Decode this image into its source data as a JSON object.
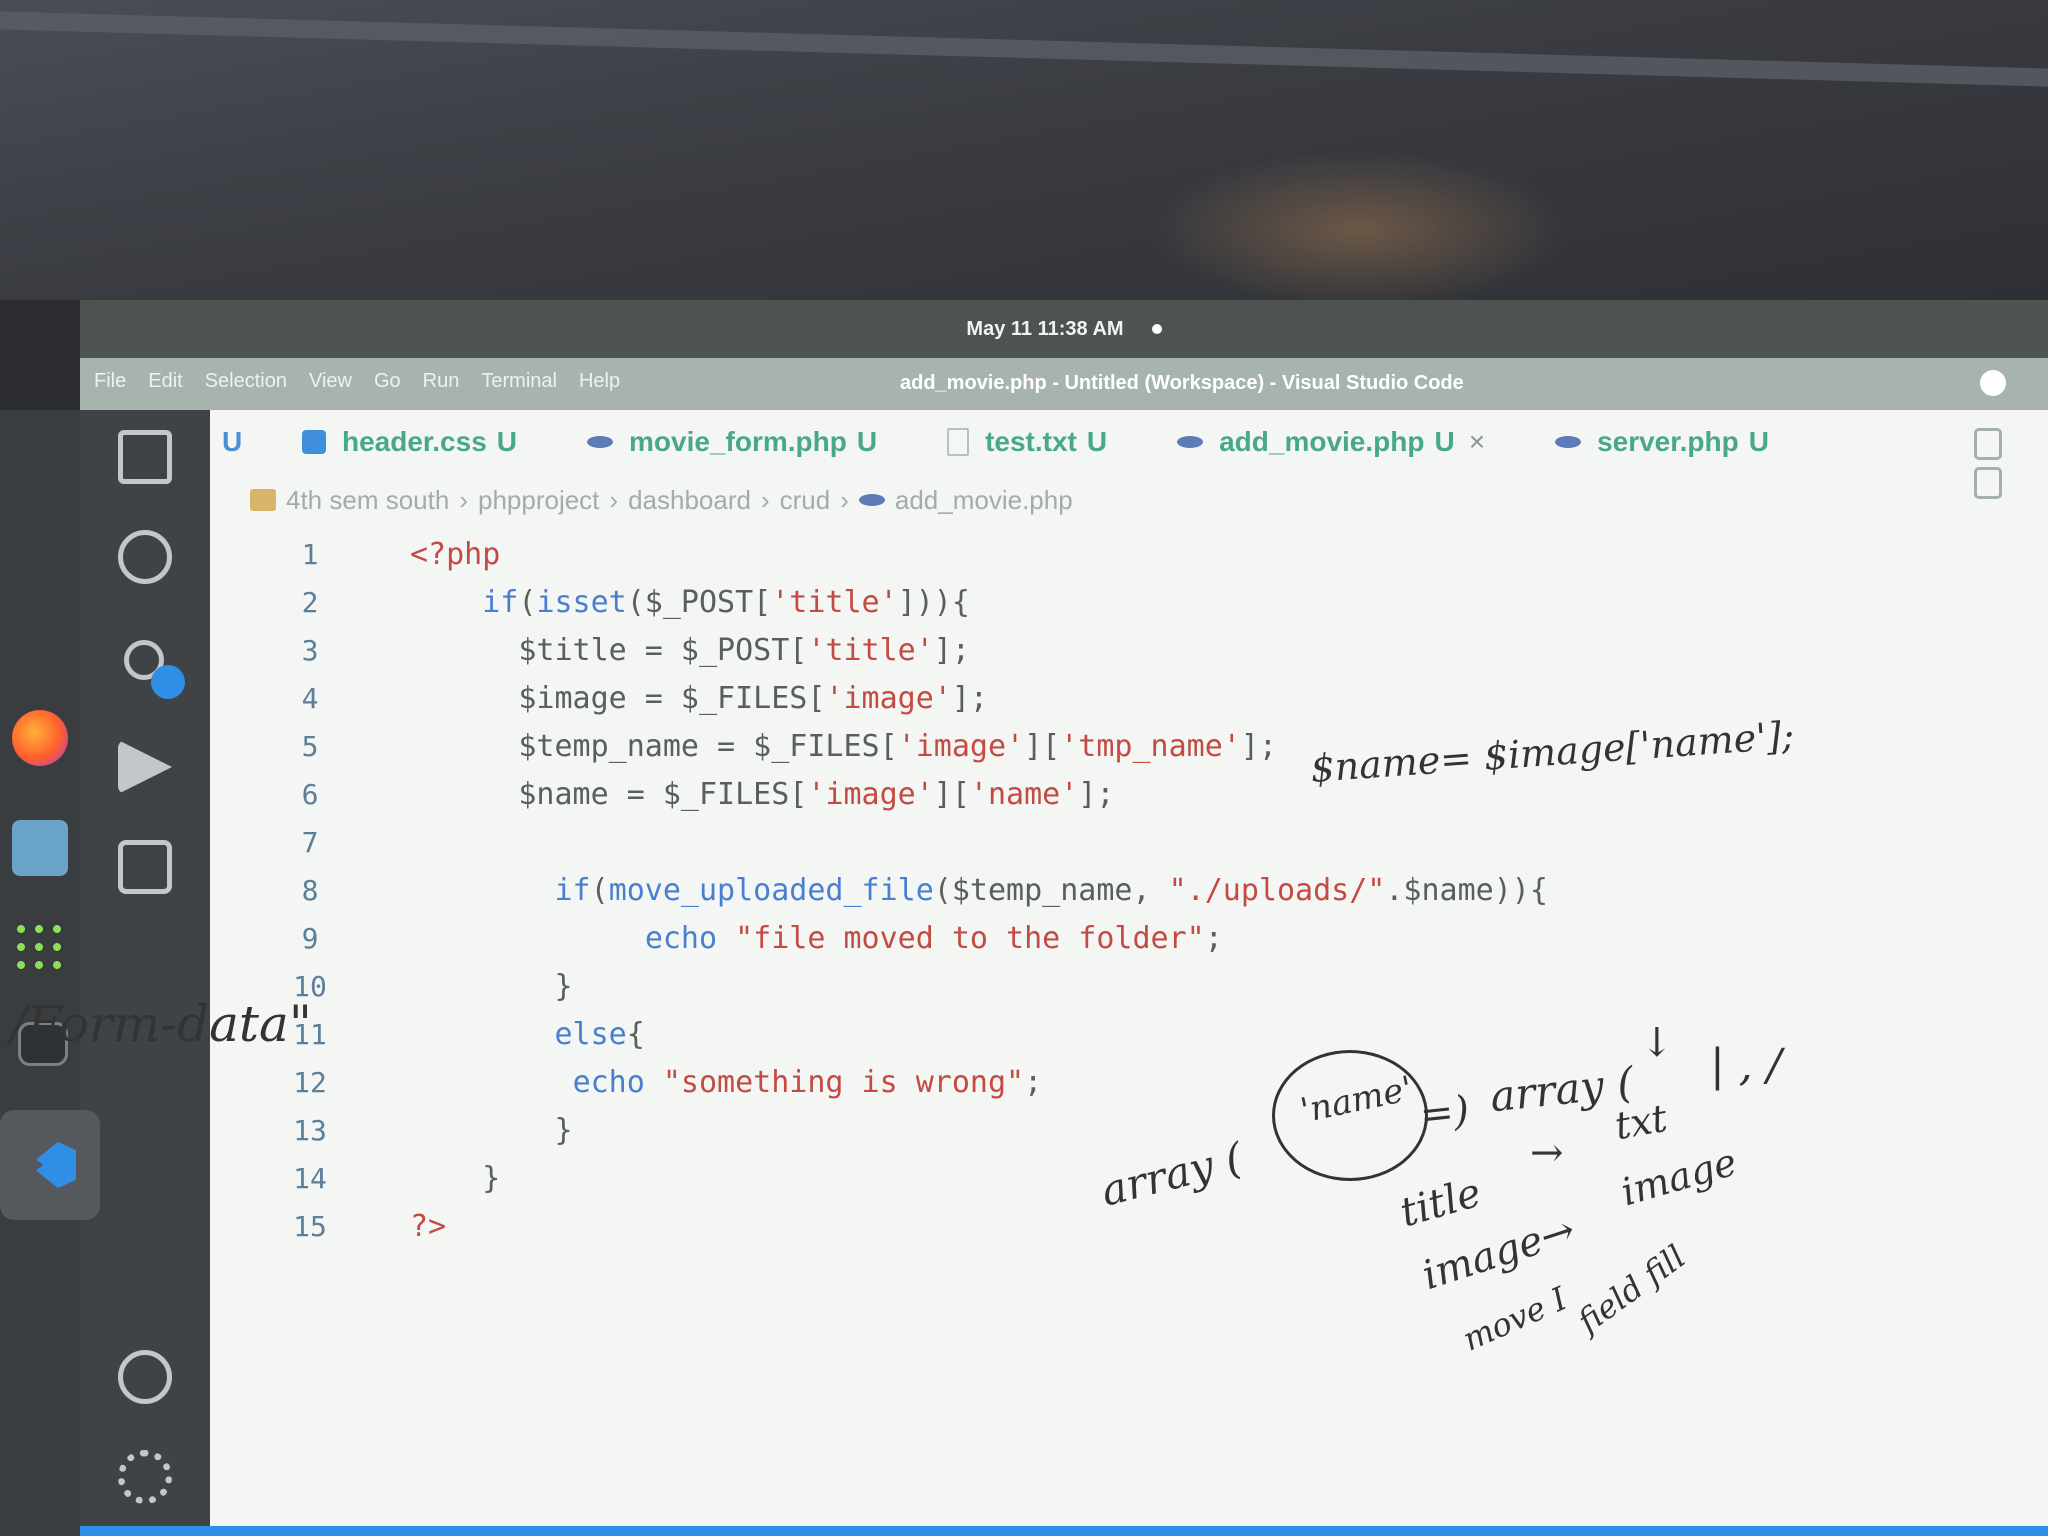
{
  "system": {
    "clock": "May 11  11:38 AM"
  },
  "window": {
    "title": "add_movie.php - Untitled (Workspace) - Visual Studio Code",
    "menu": [
      "File",
      "Edit",
      "Selection",
      "View",
      "Go",
      "Run",
      "Terminal",
      "Help"
    ]
  },
  "tabs": {
    "leading": "U",
    "items": [
      {
        "label": "header.css",
        "status": "U",
        "icon": "css-file-icon"
      },
      {
        "label": "movie_form.php",
        "status": "U",
        "icon": "php-file-icon"
      },
      {
        "label": "test.txt",
        "status": "U",
        "icon": "text-file-icon"
      },
      {
        "label": "add_movie.php",
        "status": "U",
        "icon": "php-file-icon",
        "active": true,
        "close": "×"
      },
      {
        "label": "server.php",
        "status": "U",
        "icon": "php-file-icon"
      }
    ]
  },
  "breadcrumbs": [
    "4th sem south",
    "phpproject",
    "dashboard",
    "crud",
    "add_movie.php"
  ],
  "code": [
    {
      "n": "1",
      "text": "<?php"
    },
    {
      "n": "2",
      "text": "    if(isset($_POST['title'])){"
    },
    {
      "n": "3",
      "text": "      $title = $_POST['title'];"
    },
    {
      "n": "4",
      "text": "      $image = $_FILES['image'];"
    },
    {
      "n": "5",
      "text": "      $temp_name = $_FILES['image']['tmp_name'];"
    },
    {
      "n": "6",
      "text": "      $name = $_FILES['image']['name'];"
    },
    {
      "n": "7",
      "text": ""
    },
    {
      "n": "8",
      "text": "        if(move_uploaded_file($temp_name, \"./uploads/\".$name)){"
    },
    {
      "n": "9",
      "text": "             echo \"file moved to the folder\";"
    },
    {
      "n": "10",
      "text": "        }"
    },
    {
      "n": "11",
      "text": "        else{"
    },
    {
      "n": "12",
      "text": "         echo \"something is wrong\";"
    },
    {
      "n": "13",
      "text": "        }"
    },
    {
      "n": "14",
      "text": "    }"
    },
    {
      "n": "15",
      "text": "?>"
    }
  ],
  "annotations": {
    "formdata": "/Form-data\"",
    "name_assign": "$name= $image['name'];",
    "array_left": "array (",
    "name_circled": "'name'",
    "arrow_eq": "=)",
    "array_right": "array (",
    "down_arrow": "↓",
    "bars": "|  ,  /",
    "txt": "txt",
    "title": "title",
    "arrow1": "→",
    "image_note": "image",
    "image_left": "image→",
    "move": "move I",
    "field": "field fill"
  },
  "colors": {
    "keyword": "#4a7fd0",
    "string": "#c44b44",
    "tab_text": "#4aa88a",
    "vscode_blue": "#2f8fe6"
  }
}
